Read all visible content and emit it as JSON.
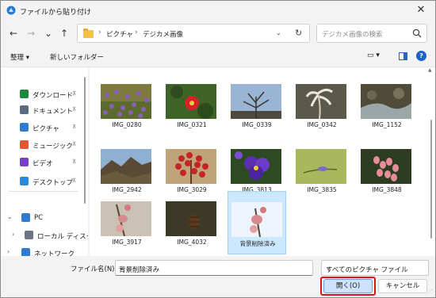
{
  "window": {
    "title": "ファイルから貼り付け",
    "close_glyph": "✕"
  },
  "nav": {
    "back_glyph": "←",
    "forward_glyph": "→",
    "recent_glyph": "⌄",
    "up_glyph": "↑",
    "breadcrumb": [
      "ピクチャ",
      "デジカメ画像"
    ],
    "breadcrumb_sep": "›",
    "refresh_glyph": "↻",
    "dropdown_glyph": "⌄",
    "search_placeholder": "デジカメ画像の検索"
  },
  "toolbar": {
    "organize_label": "整理 ▾",
    "new_folder_label": "新しいフォルダー",
    "view_label": "▭ ▾",
    "help_label": "?"
  },
  "sidebar": {
    "quick_access": [
      {
        "label": "ダウンロード",
        "icon": "download-icon",
        "color": "#1a8a3c"
      },
      {
        "label": "ドキュメント",
        "icon": "document-icon",
        "color": "#5b6b7f"
      },
      {
        "label": "ピクチャ",
        "icon": "pictures-icon",
        "color": "#2f7bd4"
      },
      {
        "label": "ミュージック",
        "icon": "music-icon",
        "color": "#e2572b"
      },
      {
        "label": "ビデオ",
        "icon": "video-icon",
        "color": "#7b3fc4"
      },
      {
        "label": "デスクトップ",
        "icon": "desktop-icon",
        "color": "#2a8ad8"
      }
    ],
    "pin_glyph": "📌",
    "tree": [
      {
        "label": "PC",
        "icon": "pc-icon",
        "chev": "⌄"
      },
      {
        "label": "ローカル ディスク",
        "icon": "disk-icon",
        "chev": "›"
      },
      {
        "label": "ネットワーク",
        "icon": "network-icon",
        "chev": "›"
      }
    ]
  },
  "files": [
    {
      "name": "IMG_0280",
      "kind": "flowers-purple"
    },
    {
      "name": "IMG_0321",
      "kind": "camellia"
    },
    {
      "name": "IMG_0339",
      "kind": "bare-tree"
    },
    {
      "name": "IMG_0342",
      "kind": "pampas"
    },
    {
      "name": "IMG_1152",
      "kind": "stream"
    },
    {
      "name": "IMG_2942",
      "kind": "mountain"
    },
    {
      "name": "IMG_3029",
      "kind": "red-tree"
    },
    {
      "name": "IMG_3813",
      "kind": "pansy"
    },
    {
      "name": "IMG_3835",
      "kind": "bud"
    },
    {
      "name": "IMG_3848",
      "kind": "pink-buds"
    },
    {
      "name": "IMG_3917",
      "kind": "peach-buds"
    },
    {
      "name": "IMG_4032",
      "kind": "pinecone"
    },
    {
      "name": "背景削除済み",
      "kind": "peach-cutout",
      "selected": true
    }
  ],
  "footer": {
    "filename_label": "ファイル名(N):",
    "filename_value": "背景削除済み",
    "filetype_value": "すべてのピクチャ ファイル",
    "dropdown_glyph": "⌄",
    "open_label": "開く(O)",
    "cancel_label": "キャンセル"
  },
  "colors": {
    "accent": "#1b63c9",
    "highlight": "#e0131b",
    "selection": "#cce8ff"
  }
}
